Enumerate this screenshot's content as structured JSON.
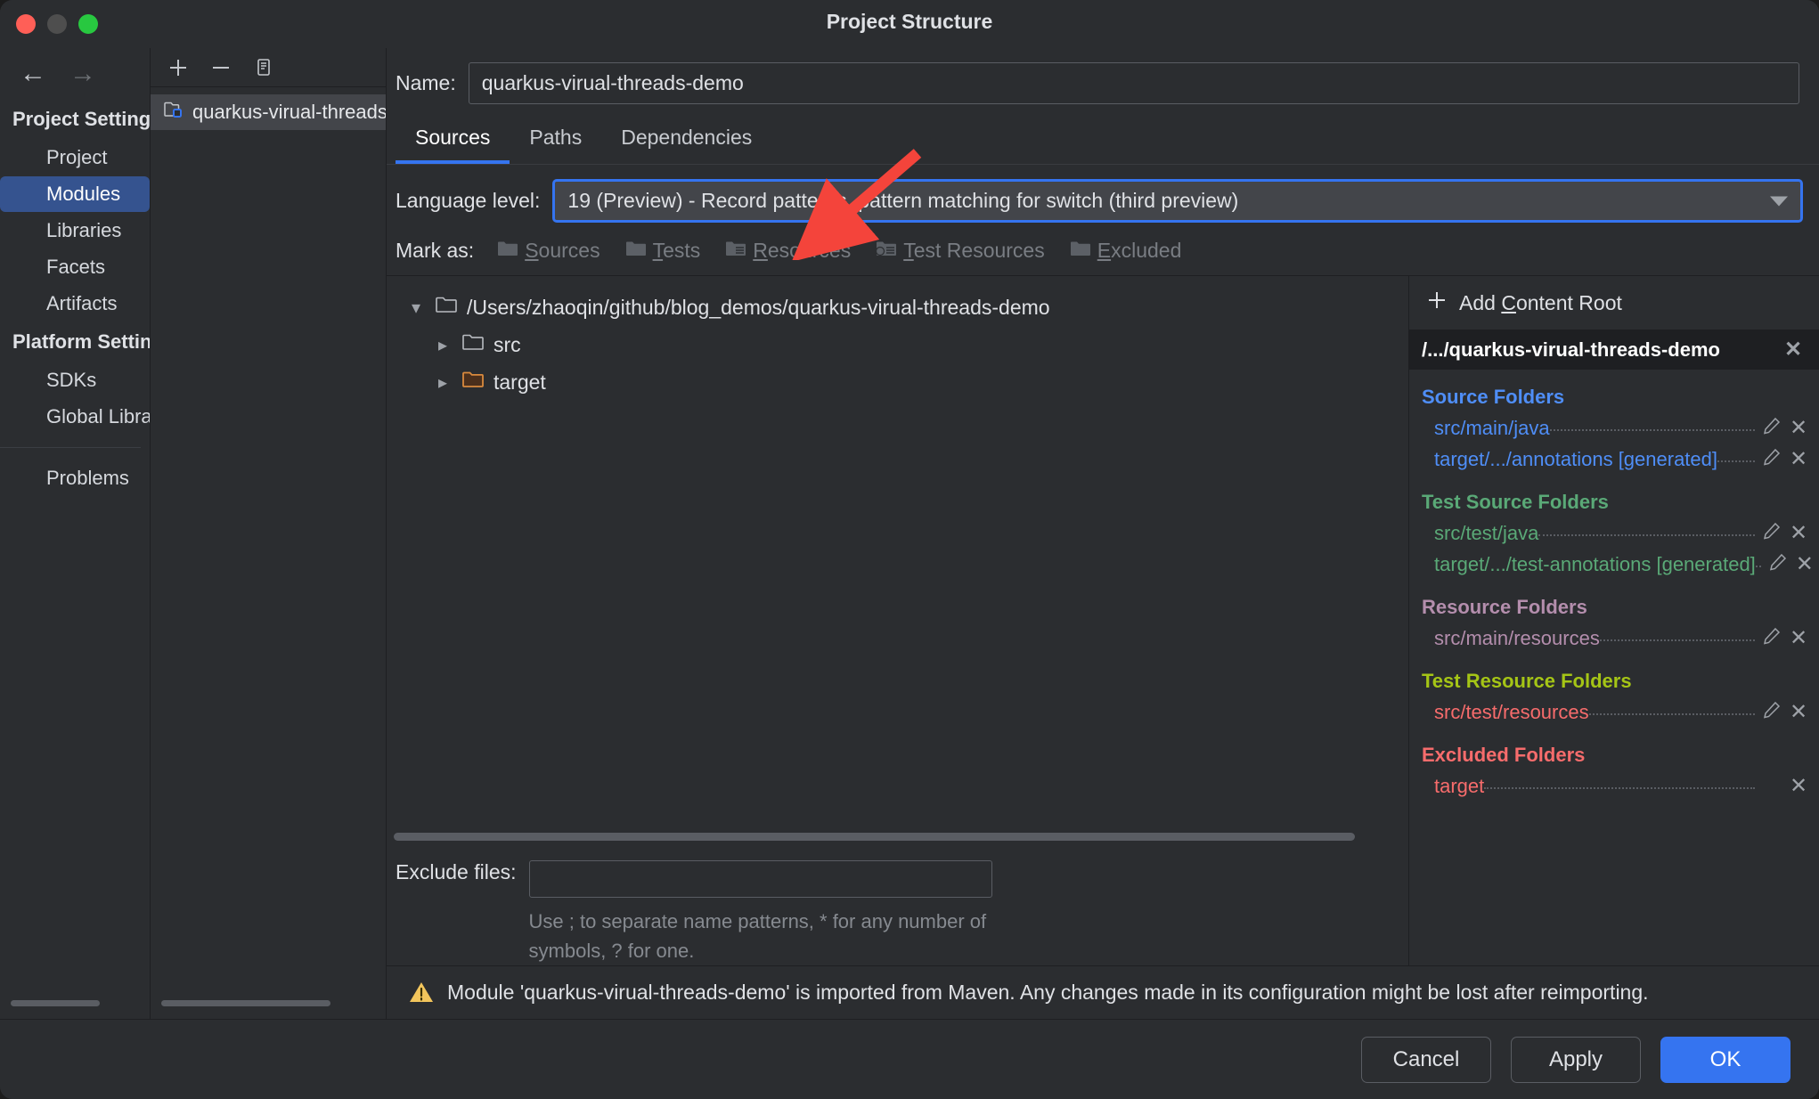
{
  "window": {
    "title": "Project Structure",
    "traffic": {
      "close": "close-button",
      "minimize": "minimize-button",
      "zoom": "zoom-button"
    }
  },
  "leftnav": {
    "back_icon": "←",
    "forward_icon": "→",
    "groups": [
      {
        "label": "Project Settings",
        "items": [
          {
            "label": "Project",
            "selected": false
          },
          {
            "label": "Modules",
            "selected": true
          },
          {
            "label": "Libraries",
            "selected": false
          },
          {
            "label": "Facets",
            "selected": false
          },
          {
            "label": "Artifacts",
            "selected": false
          }
        ]
      },
      {
        "label": "Platform Settings",
        "items": [
          {
            "label": "SDKs",
            "selected": false
          },
          {
            "label": "Global Libraries",
            "selected": false
          }
        ]
      }
    ],
    "problems": "Problems"
  },
  "modules": {
    "toolbar": {
      "add": "+",
      "remove": "−",
      "copy": "copy-icon"
    },
    "items": [
      {
        "label": "quarkus-virual-threads-demo"
      }
    ]
  },
  "main": {
    "name_label": "Name:",
    "name_value": "quarkus-virual-threads-demo",
    "tabs": [
      {
        "label": "Sources",
        "active": true
      },
      {
        "label": "Paths",
        "active": false
      },
      {
        "label": "Dependencies",
        "active": false
      }
    ],
    "language_level_label": "Language level:",
    "language_level_value": "19 (Preview) - Record patterns, pattern matching for switch (third preview)",
    "mark_as_label": "Mark as:",
    "mark_as": [
      {
        "pre": "",
        "mnem": "S",
        "post": "ources",
        "icon": "folder-sources-icon"
      },
      {
        "pre": "",
        "mnem": "T",
        "post": "ests",
        "icon": "folder-tests-icon"
      },
      {
        "pre": "",
        "mnem": "R",
        "post": "esources",
        "icon": "folder-resources-icon"
      },
      {
        "pre": "",
        "mnem": "T",
        "post": "est Resources",
        "icon": "folder-test-resources-icon"
      },
      {
        "pre": "",
        "mnem": "E",
        "post": "xcluded",
        "icon": "folder-excluded-icon"
      }
    ],
    "tree": [
      {
        "label": "/Users/zhaoqin/github/blog_demos/quarkus-virual-threads-demo",
        "indent": 0,
        "expanded": true,
        "icon": "folder-icon"
      },
      {
        "label": "src",
        "indent": 1,
        "expanded": false,
        "icon": "folder-icon"
      },
      {
        "label": "target",
        "indent": 1,
        "expanded": false,
        "icon": "folder-excluded-icon"
      }
    ],
    "exclude_label": "Exclude files:",
    "exclude_value": "",
    "exclude_hint": "Use ; to separate name patterns, * for any number of symbols, ? for one."
  },
  "roots": {
    "add_content_root": {
      "pre": "Add ",
      "mnem": "C",
      "post": "ontent Root",
      "icon": "plus-icon"
    },
    "root_path": "/.../quarkus-virual-threads-demo",
    "groups": [
      {
        "title": "Source Folders",
        "color": "#4f8ef7",
        "entries": [
          {
            "label": "src/main/java",
            "edit": true,
            "remove": true
          },
          {
            "label": "target/.../annotations [generated]",
            "edit": true,
            "remove": true
          }
        ]
      },
      {
        "title": "Test Source Folders",
        "color": "#5aa977",
        "entries": [
          {
            "label": "src/test/java",
            "edit": true,
            "remove": true
          },
          {
            "label": "target/.../test-annotations [generated]",
            "edit": true,
            "remove": true
          }
        ]
      },
      {
        "title": "Resource Folders",
        "color": "#b48ead",
        "entries": [
          {
            "label": "src/main/resources",
            "edit": true,
            "remove": true
          }
        ]
      },
      {
        "title": "Test Resource Folders",
        "color": "#a5c516",
        "entries": [
          {
            "label": "src/test/resources",
            "color": "#f76c6c",
            "edit": true,
            "remove": true
          }
        ]
      },
      {
        "title": "Excluded Folders",
        "color": "#f76c6c",
        "entries": [
          {
            "label": "target",
            "color": "#f76c6c",
            "edit": false,
            "remove": true
          }
        ]
      }
    ],
    "edit_icon": "pencil-icon",
    "remove_icon": "close-icon"
  },
  "warning": {
    "icon": "warning-icon",
    "text": "Module 'quarkus-virual-threads-demo' is imported from Maven. Any changes made in its configuration might be lost after reimporting."
  },
  "footer": {
    "buttons": [
      {
        "label": "Cancel",
        "primary": false
      },
      {
        "label": "Apply",
        "primary": false
      },
      {
        "label": "OK",
        "primary": true
      }
    ]
  },
  "annotation": {
    "type": "arrow",
    "color": "#f4443b"
  },
  "colors": {
    "accent": "#3574f0",
    "selection": "#35538f",
    "bg": "#2b2d30",
    "bg_dark": "#1e1f22",
    "text": "#dfe1e5",
    "muted": "#868a90"
  }
}
